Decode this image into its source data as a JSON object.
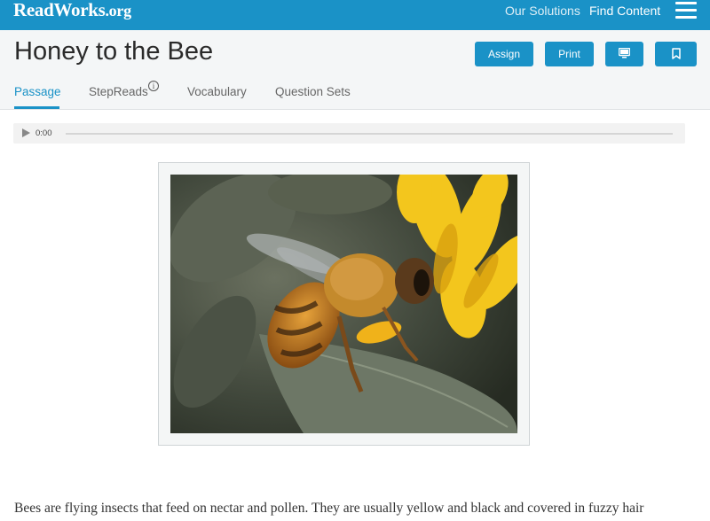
{
  "topbar": {
    "logo_main": "ReadWorks",
    "logo_tld": ".org",
    "nav": {
      "solutions": "Our Solutions",
      "find_content": "Find Content"
    }
  },
  "header": {
    "title": "Honey to the Bee",
    "buttons": {
      "assign": "Assign",
      "print": "Print"
    },
    "tabs": {
      "passage": "Passage",
      "stepreads": "StepReads",
      "vocabulary": "Vocabulary",
      "question_sets": "Question Sets"
    },
    "info_symbol": "i"
  },
  "audio": {
    "time": "0:00",
    "progress": 0
  },
  "colors": {
    "brand": "#1a92c7",
    "header_bg": "#f4f6f7"
  },
  "icons": [
    "hamburger-menu-icon",
    "info-icon",
    "play-icon",
    "monitor-icon",
    "bookmark-icon"
  ],
  "passage": {
    "first_line": "Bees are flying insects that feed on nectar and pollen. They are usually yellow and black and covered in fuzzy hair"
  }
}
